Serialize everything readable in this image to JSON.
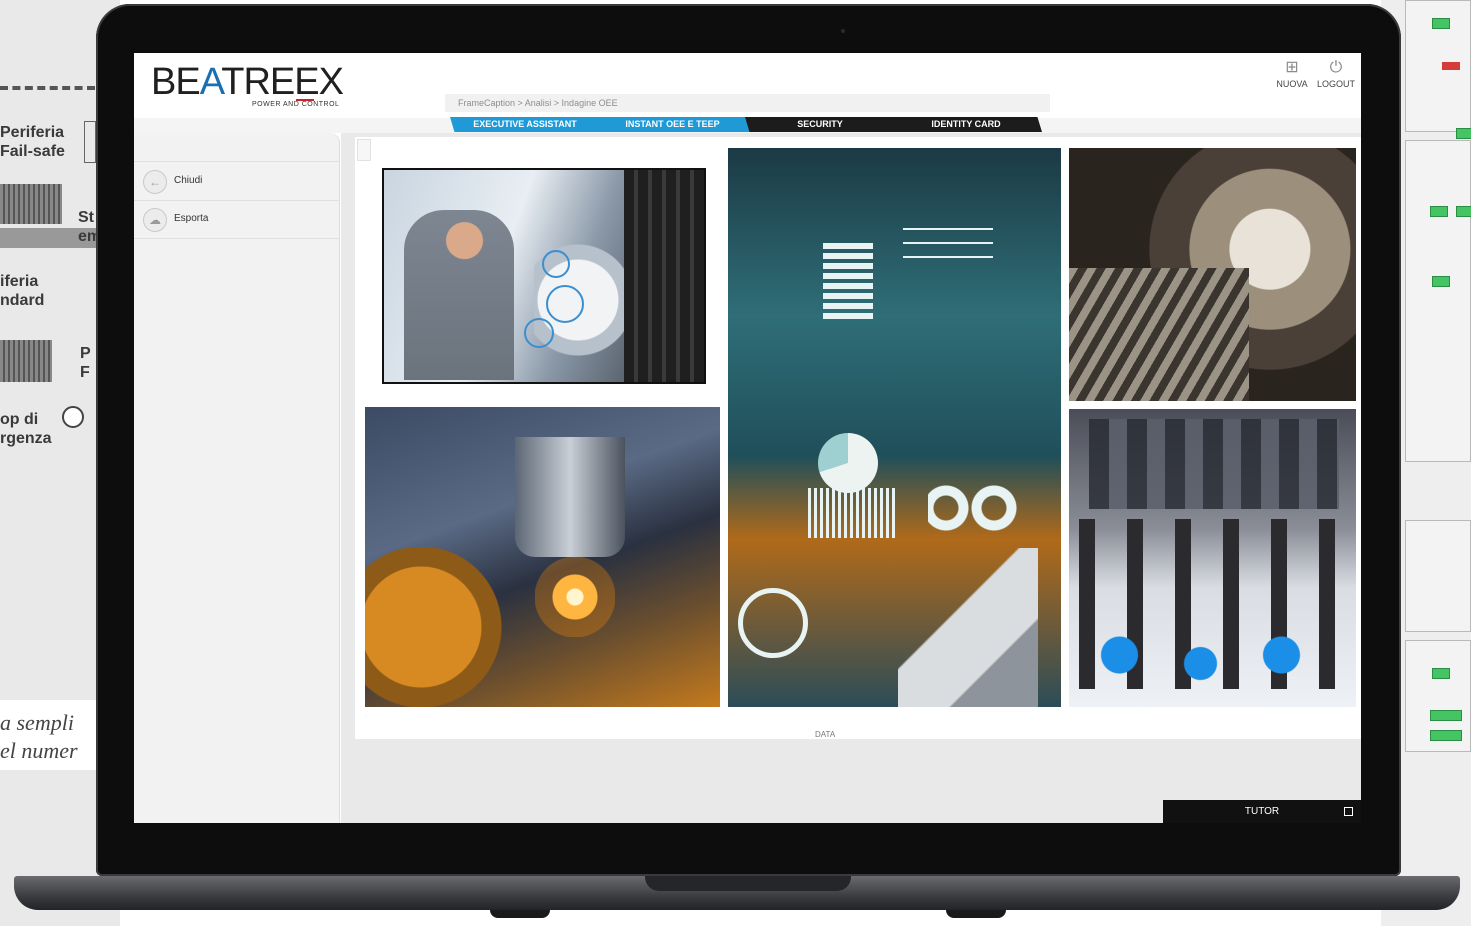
{
  "background": {
    "labels": [
      "Periferia\nFail-safe",
      "St\nem",
      "iferia\nndard",
      "P\nF",
      "op di\nrgenza"
    ],
    "caption_lines": [
      "a sempli",
      "el numer"
    ]
  },
  "brand": {
    "name_part1": "BE",
    "name_a": "A",
    "name_part2": "TREEX",
    "tagline": "POWER AND CONTROL"
  },
  "breadcrumb": "FrameCaption > Analisi > Indagine OEE",
  "tabs": [
    {
      "label": "EXECUTIVE ASSISTANT",
      "active": true
    },
    {
      "label": "INSTANT OEE E TEEP",
      "active": true
    },
    {
      "label": "SECURITY",
      "active": false
    },
    {
      "label": "IDENTITY CARD",
      "active": false
    }
  ],
  "top_actions": {
    "new_label": "NUOVA",
    "logout_label": "LOGOUT"
  },
  "sidebar": {
    "items": [
      {
        "label": "Chiudi",
        "icon": "back-arrow-icon"
      },
      {
        "label": "Esporta",
        "icon": "cloud-upload-icon"
      }
    ]
  },
  "main": {
    "x_axis_label": "DATA",
    "images": [
      {
        "name": "worker-tablet-image"
      },
      {
        "name": "cnc-laser-cutting-image"
      },
      {
        "name": "industry-dashboard-image"
      },
      {
        "name": "gears-closeup-image"
      },
      {
        "name": "trade-fair-tools-image"
      }
    ]
  },
  "tutor": {
    "label": "TUTOR"
  },
  "colors": {
    "accent": "#1f9ad7",
    "brand_a": "#1b6fb0",
    "tab_dark": "#1c1c1c"
  }
}
